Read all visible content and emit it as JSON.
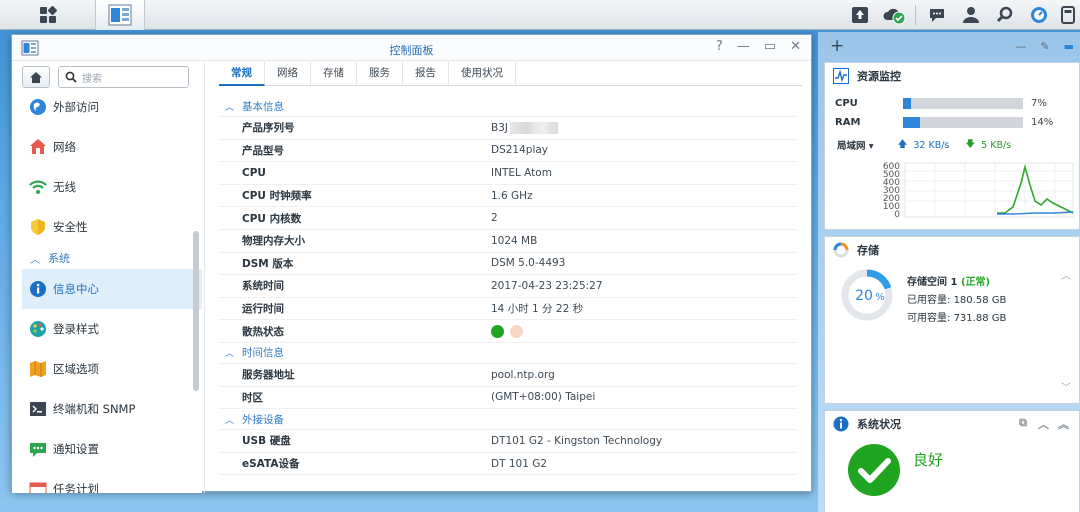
{
  "taskbar": {
    "main_menu_icon": "grid-icon",
    "control_panel_icon": "control-panel-icon",
    "right_icons": [
      "upload-icon",
      "cloud-check-icon",
      "chat-icon",
      "user-icon",
      "search-icon",
      "dashboard-icon",
      "widget-panel-icon"
    ]
  },
  "window": {
    "title": "控制面板",
    "controls": [
      "?",
      "—",
      "▭",
      "✕"
    ],
    "search_placeholder": "搜索",
    "sidebar": [
      {
        "label": "外部访问",
        "icon": "globe-icon"
      },
      {
        "label": "网络",
        "icon": "home-network-icon"
      },
      {
        "label": "无线",
        "icon": "wifi-icon"
      },
      {
        "label": "安全性",
        "icon": "shield-icon"
      },
      {
        "section": "系统"
      },
      {
        "label": "信息中心",
        "icon": "info-icon",
        "active": true
      },
      {
        "label": "登录样式",
        "icon": "palette-icon"
      },
      {
        "label": "区域选项",
        "icon": "map-icon"
      },
      {
        "label": "终端机和 SNMP",
        "icon": "terminal-icon"
      },
      {
        "label": "通知设置",
        "icon": "notification-icon"
      },
      {
        "label": "任务计划",
        "icon": "calendar-icon"
      }
    ],
    "tabs": [
      "常规",
      "网络",
      "存储",
      "服务",
      "报告",
      "使用状况"
    ],
    "sections": {
      "basic": {
        "title": "基本信息",
        "rows": [
          {
            "key": "产品序列号",
            "value": "B3J"
          },
          {
            "key": "产品型号",
            "value": "DS214play"
          },
          {
            "key": "CPU",
            "value": "INTEL Atom"
          },
          {
            "key": "CPU 时钟频率",
            "value": "1.6 GHz"
          },
          {
            "key": "CPU 内核数",
            "value": "2"
          },
          {
            "key": "物理内存大小",
            "value": "1024 MB"
          },
          {
            "key": "DSM 版本",
            "value": "DSM 5.0-4493"
          },
          {
            "key": "系统时间",
            "value": "2017-04-23 23:25:27"
          },
          {
            "key": "运行时间",
            "value": "14 小时 1 分 22 秒"
          },
          {
            "key": "散热状态",
            "value": ""
          }
        ]
      },
      "time": {
        "title": "时间信息",
        "rows": [
          {
            "key": "服务器地址",
            "value": "pool.ntp.org"
          },
          {
            "key": "时区",
            "value": "(GMT+08:00) Taipei"
          }
        ]
      },
      "ext": {
        "title": "外接设备",
        "rows": [
          {
            "key": "USB 硬盘",
            "value": "DT101 G2 - Kingston Technology"
          },
          {
            "key": "eSATA设备",
            "value": "DT 101 G2"
          }
        ]
      }
    },
    "thermal_colors": [
      "#1fa51f",
      "#f6d6c2"
    ]
  },
  "widgets": {
    "resource": {
      "title": "资源监控",
      "cpu_label": "CPU",
      "cpu_pct": 7,
      "cpu_text": "7%",
      "ram_label": "RAM",
      "ram_pct": 14,
      "ram_text": "14%",
      "lan_label": "局域网 ▾",
      "upload": "32 KB/s",
      "download": "5 KB/s",
      "chart_ticks": [
        "600",
        "500",
        "400",
        "300",
        "200",
        "100",
        "0"
      ]
    },
    "storage": {
      "title": "存储",
      "percent_text": "20",
      "percent_sign": "%",
      "percent_value": 20,
      "volume_name": "存储空间 1",
      "volume_status": "(正常)",
      "used_label": "已用容量:",
      "used_value": "180.58 GB",
      "free_label": "可用容量:",
      "free_value": "731.88 GB"
    },
    "health": {
      "title": "系统状况",
      "status": "良好"
    }
  },
  "colors": {
    "accent": "#1d6fc4",
    "green": "#1fa51f"
  }
}
